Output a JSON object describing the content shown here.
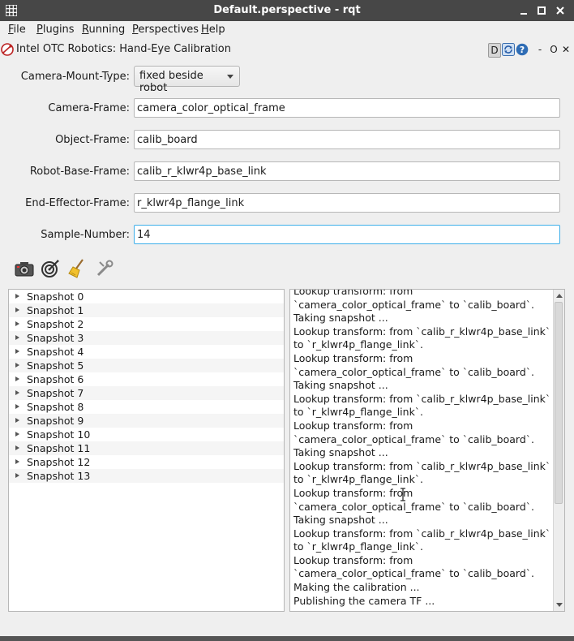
{
  "window": {
    "title": "Default.perspective - rqt"
  },
  "menubar": {
    "items": [
      {
        "label": "File",
        "mnemonic": "F",
        "rest": "ile"
      },
      {
        "label": "Plugins",
        "mnemonic": "P",
        "rest": "lugins"
      },
      {
        "label": "Running",
        "mnemonic": "R",
        "rest": "unning"
      },
      {
        "label": "Perspectives",
        "mnemonic": "P",
        "rest": "erspectives"
      },
      {
        "label": "Help",
        "mnemonic": "H",
        "rest": "elp"
      }
    ]
  },
  "plugin": {
    "title": "Intel OTC Robotics: Hand-Eye Calibration",
    "d_label": "D",
    "dash_label": "-",
    "o_label": "O",
    "close_label": "✕"
  },
  "form": {
    "mount_type_label": "Camera-Mount-Type:",
    "mount_type_value": "fixed beside robot",
    "camera_frame_label": "Camera-Frame:",
    "camera_frame_value": "camera_color_optical_frame",
    "object_frame_label": "Object-Frame:",
    "object_frame_value": "calib_board",
    "robot_base_frame_label": "Robot-Base-Frame:",
    "robot_base_frame_value": "calib_r_klwr4p_base_link",
    "end_effector_frame_label": "End-Effector-Frame:",
    "end_effector_frame_value": "r_klwr4p_flange_link",
    "sample_number_label": "Sample-Number:",
    "sample_number_value": "14"
  },
  "toolbar": {
    "icons": [
      "camera-icon",
      "target-icon",
      "broom-icon",
      "tool-icon"
    ]
  },
  "snapshots": [
    "Snapshot 0",
    "Snapshot 1",
    "Snapshot 2",
    "Snapshot 3",
    "Snapshot 4",
    "Snapshot 5",
    "Snapshot 6",
    "Snapshot 7",
    "Snapshot 8",
    "Snapshot 9",
    "Snapshot 10",
    "Snapshot 11",
    "Snapshot 12",
    "Snapshot 13"
  ],
  "log": [
    "Lookup transform: from `camera_color_optical_frame` to `calib_board`.",
    "Taking snapshot ...",
    "Lookup transform: from `calib_r_klwr4p_base_link` to `r_klwr4p_flange_link`.",
    "Lookup transform: from `camera_color_optical_frame` to `calib_board`.",
    "Taking snapshot ...",
    "Lookup transform: from `calib_r_klwr4p_base_link` to `r_klwr4p_flange_link`.",
    "Lookup transform: from `camera_color_optical_frame` to `calib_board`.",
    "Taking snapshot ...",
    "Lookup transform: from `calib_r_klwr4p_base_link` to `r_klwr4p_flange_link`.",
    "Lookup transform: from `camera_color_optical_frame` to `calib_board`.",
    "Taking snapshot ...",
    "Lookup transform: from `calib_r_klwr4p_base_link` to `r_klwr4p_flange_link`.",
    "Lookup transform: from `camera_color_optical_frame` to `calib_board`.",
    "Making the calibration ...",
    "Publishing the camera TF ..."
  ],
  "colors": {
    "titlebar": "#474747",
    "focus": "#3daee9",
    "background": "#efefef"
  }
}
